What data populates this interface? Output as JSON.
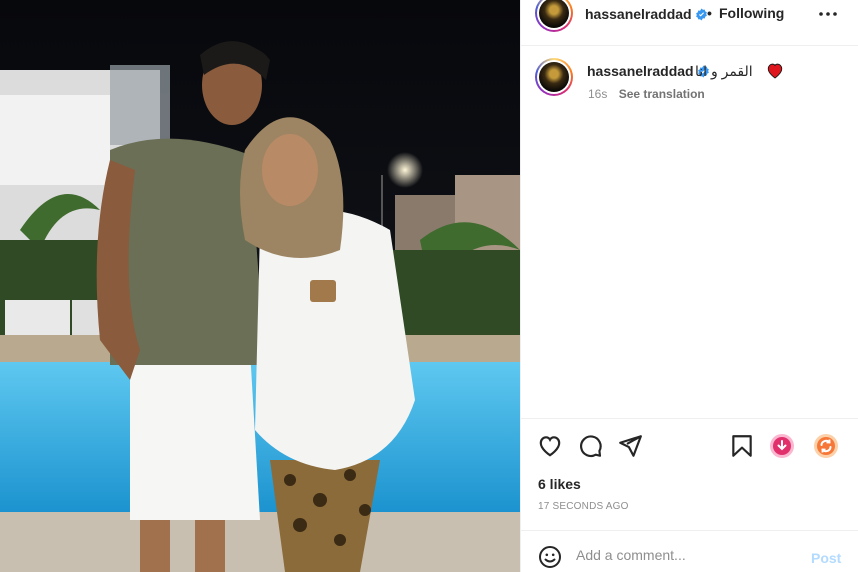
{
  "post": {
    "author": "hassanelraddad",
    "follow_separator": "•",
    "follow_status": "Following",
    "caption_text": "القمر و انا",
    "caption_emoji": "red-heart",
    "caption_age": "16s",
    "see_translation": "See translation",
    "likes": "6 likes",
    "timestamp": "17 SECONDS AGO"
  },
  "comment": {
    "placeholder": "Add a comment...",
    "post_label": "Post"
  },
  "icons": {
    "more": "more-options-icon",
    "like": "heart-icon",
    "comment": "comment-icon",
    "share": "share-icon",
    "save": "bookmark-icon",
    "emoji": "emoji-icon",
    "verified": "verified-badge-icon",
    "download": "download-extension-icon",
    "repost": "repost-extension-icon"
  },
  "colors": {
    "verified": "#3897f0",
    "text": "#262626",
    "muted": "#8e8e8e",
    "post_disabled": "#b3dbff",
    "ext_pink": "#e1306c",
    "ext_orange": "#f77737"
  }
}
